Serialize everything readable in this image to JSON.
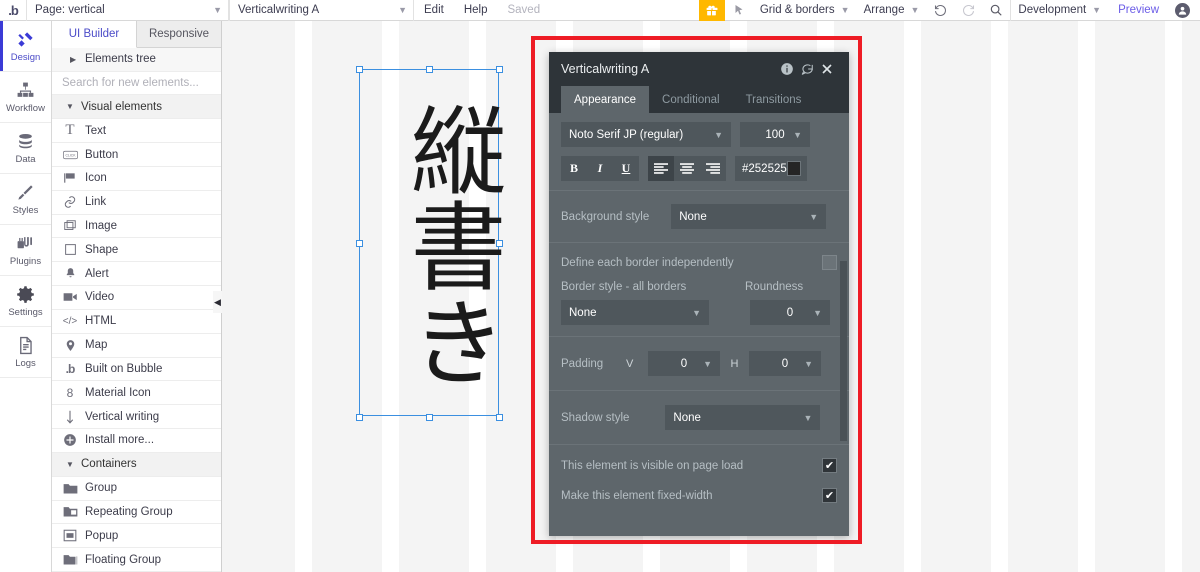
{
  "topbar": {
    "logo": "bubble-logo",
    "page_label": "Page: vertical",
    "element_label": "Verticalwriting A",
    "edit": "Edit",
    "help": "Help",
    "saved": "Saved",
    "gift_icon": "gift-icon",
    "pointer_icon": "pointer-icon",
    "grid_borders": "Grid & borders",
    "arrange": "Arrange",
    "undo_icon": "undo-icon",
    "redo_icon": "redo-icon",
    "search_icon": "search-icon",
    "version": "Development",
    "preview": "Preview",
    "avatar": "user-avatar"
  },
  "rail": {
    "items": [
      {
        "label": "Design",
        "icon": "design-icon",
        "active": true
      },
      {
        "label": "Workflow",
        "icon": "workflow-icon",
        "active": false
      },
      {
        "label": "Data",
        "icon": "data-icon",
        "active": false
      },
      {
        "label": "Styles",
        "icon": "styles-icon",
        "active": false
      },
      {
        "label": "Plugins",
        "icon": "plugins-icon",
        "active": false
      },
      {
        "label": "Settings",
        "icon": "settings-icon",
        "active": false
      },
      {
        "label": "Logs",
        "icon": "logs-icon",
        "active": false
      }
    ]
  },
  "elements_panel": {
    "tabs": [
      {
        "label": "UI Builder",
        "active": true
      },
      {
        "label": "Responsive",
        "active": false
      }
    ],
    "tree_label": "Elements tree",
    "search_placeholder": "Search for new elements...",
    "visual_section": "Visual elements",
    "visual_items": [
      {
        "label": "Text",
        "icon": "text-icon"
      },
      {
        "label": "Button",
        "icon": "button-icon"
      },
      {
        "label": "Icon",
        "icon": "flag-icon"
      },
      {
        "label": "Link",
        "icon": "link-icon"
      },
      {
        "label": "Image",
        "icon": "image-icon"
      },
      {
        "label": "Shape",
        "icon": "shape-icon"
      },
      {
        "label": "Alert",
        "icon": "bell-icon"
      },
      {
        "label": "Video",
        "icon": "video-icon"
      },
      {
        "label": "HTML",
        "icon": "html-icon"
      },
      {
        "label": "Map",
        "icon": "map-pin-icon"
      },
      {
        "label": "Built on Bubble",
        "icon": "bubble-icon"
      },
      {
        "label": "Material Icon",
        "icon": "material-icon"
      },
      {
        "label": "Vertical writing",
        "icon": "down-arrow-icon"
      },
      {
        "label": "Install more...",
        "icon": "plus-circle-icon"
      }
    ],
    "containers_section": "Containers",
    "container_items": [
      {
        "label": "Group",
        "icon": "folder-icon"
      },
      {
        "label": "Repeating Group",
        "icon": "repeating-folder-icon"
      },
      {
        "label": "Popup",
        "icon": "popup-icon"
      },
      {
        "label": "Floating Group",
        "icon": "floating-folder-icon"
      }
    ],
    "collapse_icon": "collapse-left-icon"
  },
  "canvas": {
    "element_text": "縦書き",
    "selection": "selected-element-handles"
  },
  "property_editor": {
    "title": "Verticalwriting A",
    "info_icon": "info-icon",
    "comment_icon": "comment-icon",
    "close_icon": "close-icon",
    "tabs": [
      {
        "label": "Appearance",
        "active": true
      },
      {
        "label": "Conditional",
        "active": false
      },
      {
        "label": "Transitions",
        "active": false
      }
    ],
    "font_family": "Noto Serif JP (regular)",
    "font_size": "100",
    "bold": "B",
    "italic": "I",
    "underline": "U",
    "align_left_icon": "align-left-icon",
    "align_center_icon": "align-center-icon",
    "align_right_icon": "align-right-icon",
    "font_color": "#252525",
    "background_style_label": "Background style",
    "background_style_value": "None",
    "define_borders_label": "Define each border independently",
    "define_borders_checked": false,
    "border_style_label": "Border style - all borders",
    "border_style_value": "None",
    "roundness_label": "Roundness",
    "roundness_value": "0",
    "padding_label": "Padding",
    "padding_v_label": "V",
    "padding_v_value": "0",
    "padding_h_label": "H",
    "padding_h_value": "0",
    "shadow_style_label": "Shadow style",
    "shadow_style_value": "None",
    "visible_label": "This element is visible on page load",
    "visible_checked": true,
    "fixed_width_label": "Make this element fixed-width",
    "fixed_width_checked": true
  },
  "highlight": {
    "name": "red-annotation-box",
    "color": "#ee1c25"
  }
}
